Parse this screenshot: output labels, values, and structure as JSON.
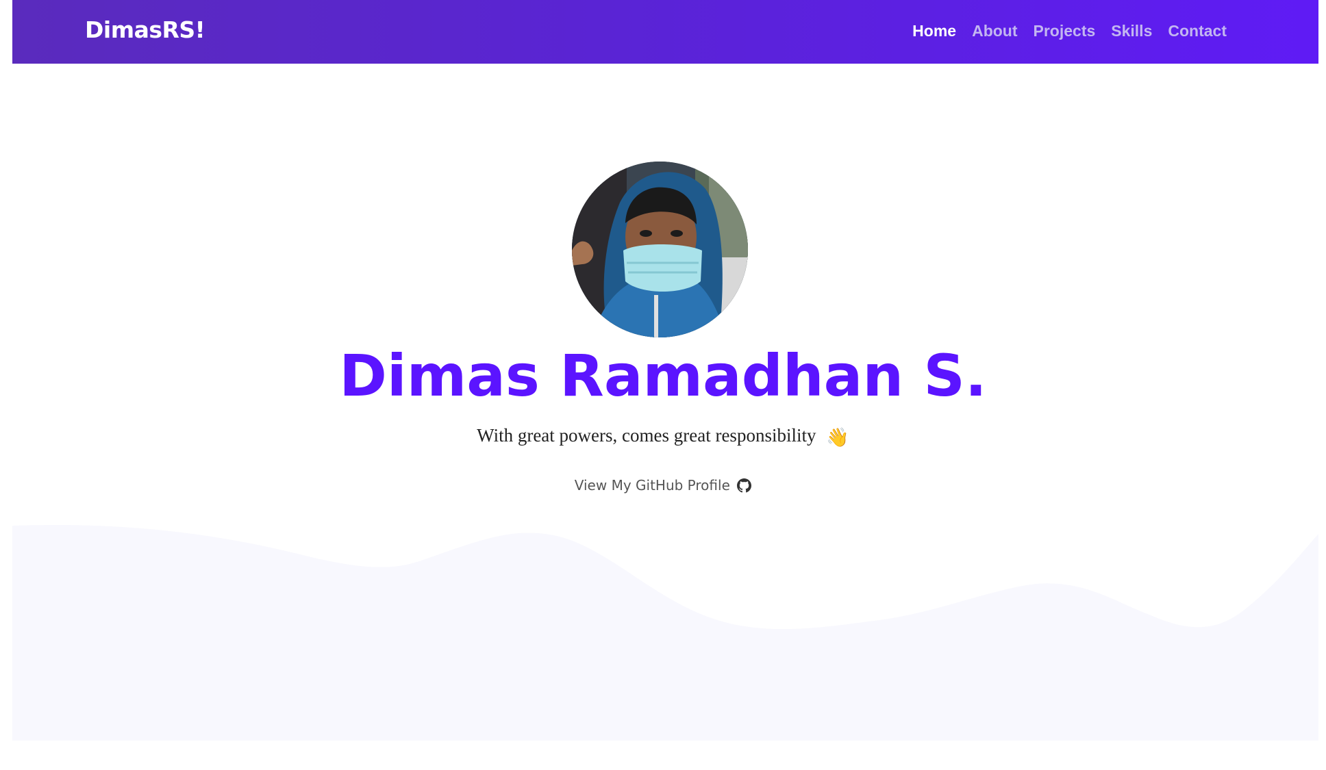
{
  "navbar": {
    "brand": "DimasRS!",
    "links": [
      {
        "label": "Home",
        "active": true
      },
      {
        "label": "About",
        "active": false
      },
      {
        "label": "Projects",
        "active": false
      },
      {
        "label": "Skills",
        "active": false
      },
      {
        "label": "Contact",
        "active": false
      }
    ]
  },
  "hero": {
    "name": "Dimas Ramadhan S.",
    "tagline": "With great powers, comes great responsibility",
    "tagline_emoji": "👋",
    "github_label": "View My GitHub Profile",
    "github_icon": "github-icon"
  },
  "colors": {
    "accent": "#5b14ff",
    "navbar_start": "#5a2bbd",
    "navbar_end": "#5f1bf5",
    "wave": "#f8f8fe"
  }
}
